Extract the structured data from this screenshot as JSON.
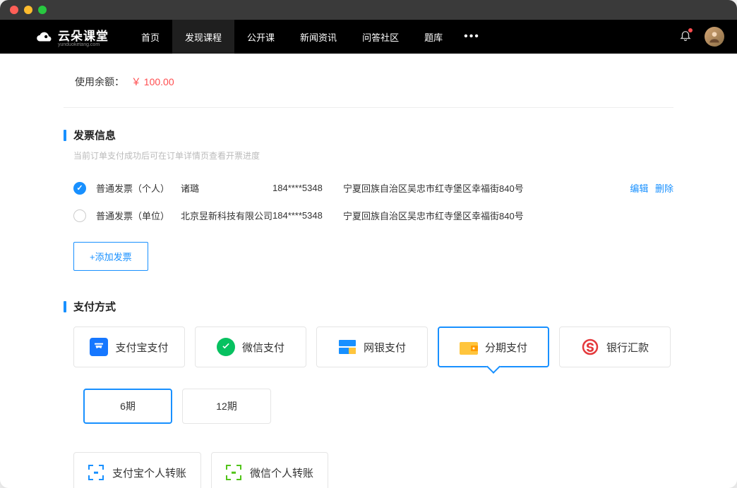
{
  "nav": {
    "brand": "云朵课堂",
    "brand_sub": "yunduoketang.com",
    "items": [
      "首页",
      "发现课程",
      "公开课",
      "新闻资讯",
      "问答社区",
      "题库"
    ],
    "active_index": 1
  },
  "balance": {
    "label": "使用余额：",
    "amount": "￥ 100.00"
  },
  "invoice": {
    "title": "发票信息",
    "subtitle": "当前订单支付成功后可在订单详情页查看开票进度",
    "rows": [
      {
        "type": "普通发票（个人）",
        "name": "诸璐",
        "phone": "184****5348",
        "addr": "宁夏回族自治区吴忠市红寺堡区幸福街840号",
        "checked": true,
        "edit": "编辑",
        "del": "删除"
      },
      {
        "type": "普通发票（单位）",
        "name": "北京昱新科技有限公司",
        "phone": "184****5348",
        "addr": "宁夏回族自治区吴忠市红寺堡区幸福街840号",
        "checked": false
      }
    ],
    "add_label": "+添加发票"
  },
  "payment": {
    "title": "支付方式",
    "methods": [
      {
        "label": "支付宝支付",
        "icon": "alipay"
      },
      {
        "label": "微信支付",
        "icon": "wechat"
      },
      {
        "label": "网银支付",
        "icon": "unionpay"
      },
      {
        "label": "分期支付",
        "icon": "installment",
        "selected": true
      },
      {
        "label": "银行汇款",
        "icon": "bank"
      }
    ],
    "periods": [
      {
        "label": "6期",
        "selected": true
      },
      {
        "label": "12期",
        "selected": false
      }
    ],
    "transfers": [
      {
        "label": "支付宝个人转账",
        "color": "blue"
      },
      {
        "label": "微信个人转账",
        "color": "green"
      }
    ]
  }
}
